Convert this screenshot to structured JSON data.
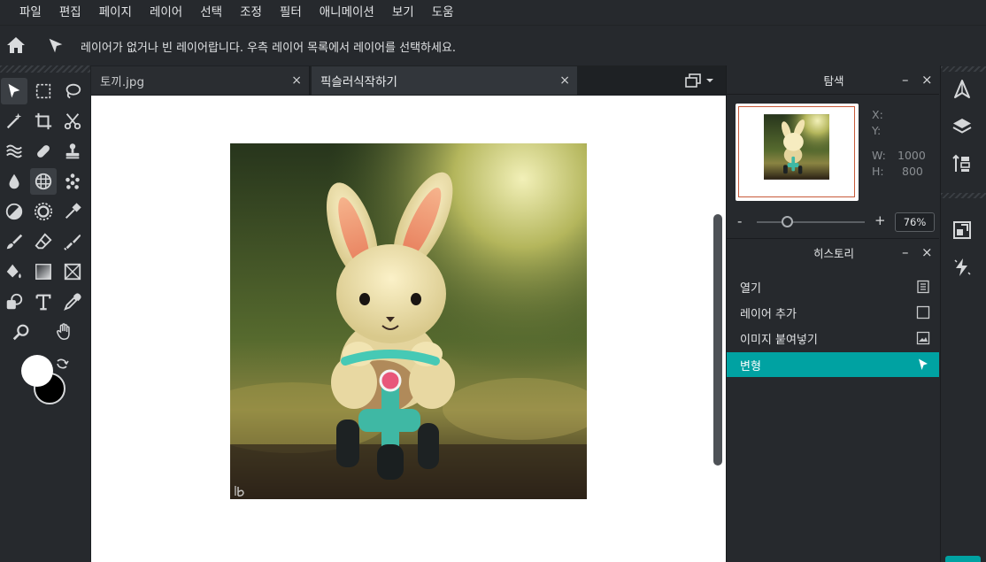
{
  "menu": [
    "파일",
    "편집",
    "페이지",
    "레이어",
    "선택",
    "조정",
    "필터",
    "애니메이션",
    "보기",
    "도움"
  ],
  "options_bar": {
    "message": "레이어가 없거나 빈 레이어랍니다. 우측 레이어 목록에서 레이어를 선택하세요."
  },
  "tabs": [
    {
      "label": "토끼.jpg",
      "close": "×"
    },
    {
      "label": "픽슬러식작하기",
      "close": "×"
    }
  ],
  "navigator": {
    "title": "탐색",
    "minimize": "–",
    "close": "×",
    "x_label": "X:",
    "y_label": "Y:",
    "w_label": "W:",
    "w_value": "1000",
    "h_label": "H:",
    "h_value": "800",
    "zoom_minus": "-",
    "zoom_plus": "+",
    "zoom_value": "76%"
  },
  "history": {
    "title": "히스토리",
    "minimize": "–",
    "close": "×",
    "items": [
      {
        "label": "열기",
        "icon": "document-icon"
      },
      {
        "label": "레이어 추가",
        "icon": "layer-square-icon"
      },
      {
        "label": "이미지 붙여넣기",
        "icon": "image-icon"
      },
      {
        "label": "변형",
        "icon": "pointer-icon"
      }
    ],
    "active_index": 3
  },
  "colors": {
    "accent": "#00a2a2",
    "foreground": "#ffffff",
    "background": "#000000"
  }
}
